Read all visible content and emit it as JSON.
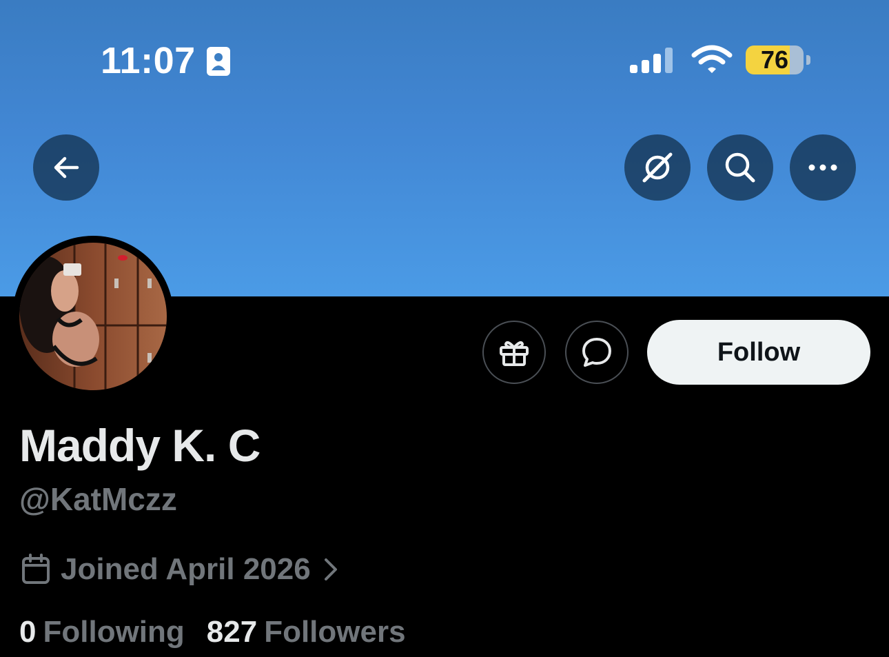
{
  "status_bar": {
    "time": "11:07",
    "battery_level": "76",
    "icons": [
      "focus-contact-icon",
      "cellular-signal-icon",
      "wifi-icon",
      "battery-icon"
    ]
  },
  "header": {
    "banner_color": "#4a96e2",
    "buttons": [
      {
        "name": "back-button",
        "icon": "arrow-left-icon"
      },
      {
        "name": "grok-button",
        "icon": "grok-icon"
      },
      {
        "name": "search-button",
        "icon": "search-icon"
      },
      {
        "name": "more-button",
        "icon": "more-horizontal-icon"
      }
    ]
  },
  "profile": {
    "display_name": "Maddy K. C",
    "handle": "@KatMczz",
    "joined": "Joined April 2026",
    "following_count": "0",
    "following_label": "Following",
    "followers_count": "827",
    "followers_label": "Followers"
  },
  "actions": {
    "gift_icon": "gift-icon",
    "message_icon": "message-bubble-icon",
    "follow_label": "Follow"
  },
  "colors": {
    "background": "#000000",
    "primary_text": "#e7e9ea",
    "secondary_text": "#71767b",
    "follow_button_bg": "#eff3f4",
    "battery_fill": "#f4d340"
  }
}
